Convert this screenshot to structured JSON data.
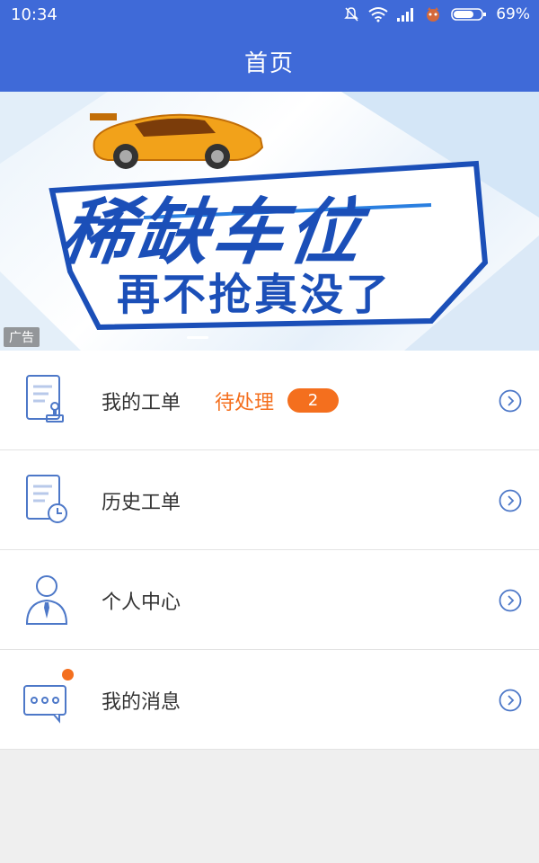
{
  "status_bar": {
    "time": "10:34",
    "battery": "69%",
    "icons": [
      "mute-icon",
      "wifi-icon",
      "signal-icon",
      "app-notification-icon",
      "battery-icon"
    ]
  },
  "nav": {
    "title": "首页"
  },
  "banner": {
    "headline_main": "稀缺车位",
    "headline_sub": "再不抢真没了",
    "ad_tag": "广告",
    "colors": {
      "primary": "#1b4fb8",
      "accent": "#f2a21a"
    }
  },
  "menu": {
    "items": [
      {
        "label": "我的工单",
        "status": "待处理",
        "badge": "2",
        "icon": "work-order-stamp-icon"
      },
      {
        "label": "历史工单",
        "icon": "history-order-clock-icon"
      },
      {
        "label": "个人中心",
        "icon": "user-profile-icon"
      },
      {
        "label": "我的消息",
        "icon": "message-bubble-icon"
      }
    ]
  },
  "theme": {
    "nav_color": "#3f6ad8",
    "accent_color": "#f46f1e",
    "icon_color": "#4d78c8"
  }
}
